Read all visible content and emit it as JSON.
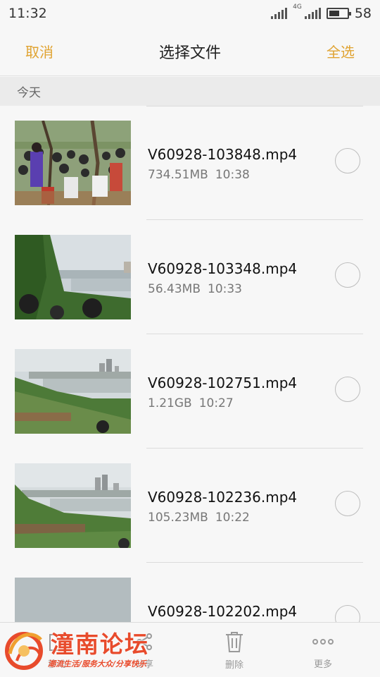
{
  "status_bar": {
    "time": "11:32",
    "network": "4G",
    "battery_percent": "58",
    "battery_level": 0.58
  },
  "header": {
    "cancel_label": "取消",
    "title": "选择文件",
    "select_all_label": "全选"
  },
  "section": {
    "label": "今天"
  },
  "files": [
    {
      "name": "V60928-103848.mp4",
      "size": "734.51MB",
      "time": "10:38",
      "thumbnail": "crowd-scene"
    },
    {
      "name": "V60928-103348.mp4",
      "size": "56.43MB",
      "time": "10:33",
      "thumbnail": "river-view"
    },
    {
      "name": "V60928-102751.mp4",
      "size": "1.21GB",
      "time": "10:27",
      "thumbnail": "river-city-view"
    },
    {
      "name": "V60928-102236.mp4",
      "size": "105.23MB",
      "time": "10:22",
      "thumbnail": "river-city-view"
    },
    {
      "name": "V60928-102202.mp4",
      "size": "",
      "time": "",
      "thumbnail": "grey-sky"
    }
  ],
  "toolbar": {
    "items": [
      {
        "label": "移动",
        "icon": "move-icon"
      },
      {
        "label": "分享",
        "icon": "share-icon"
      },
      {
        "label": "删除",
        "icon": "trash-icon"
      },
      {
        "label": "更多",
        "icon": "more-icon"
      }
    ]
  },
  "watermark": {
    "name": "潼南论坛",
    "slogan": "潮流生活/服务大众/分享快乐"
  },
  "colors": {
    "accent": "#e0a331",
    "watermark": "#e84b2c"
  }
}
